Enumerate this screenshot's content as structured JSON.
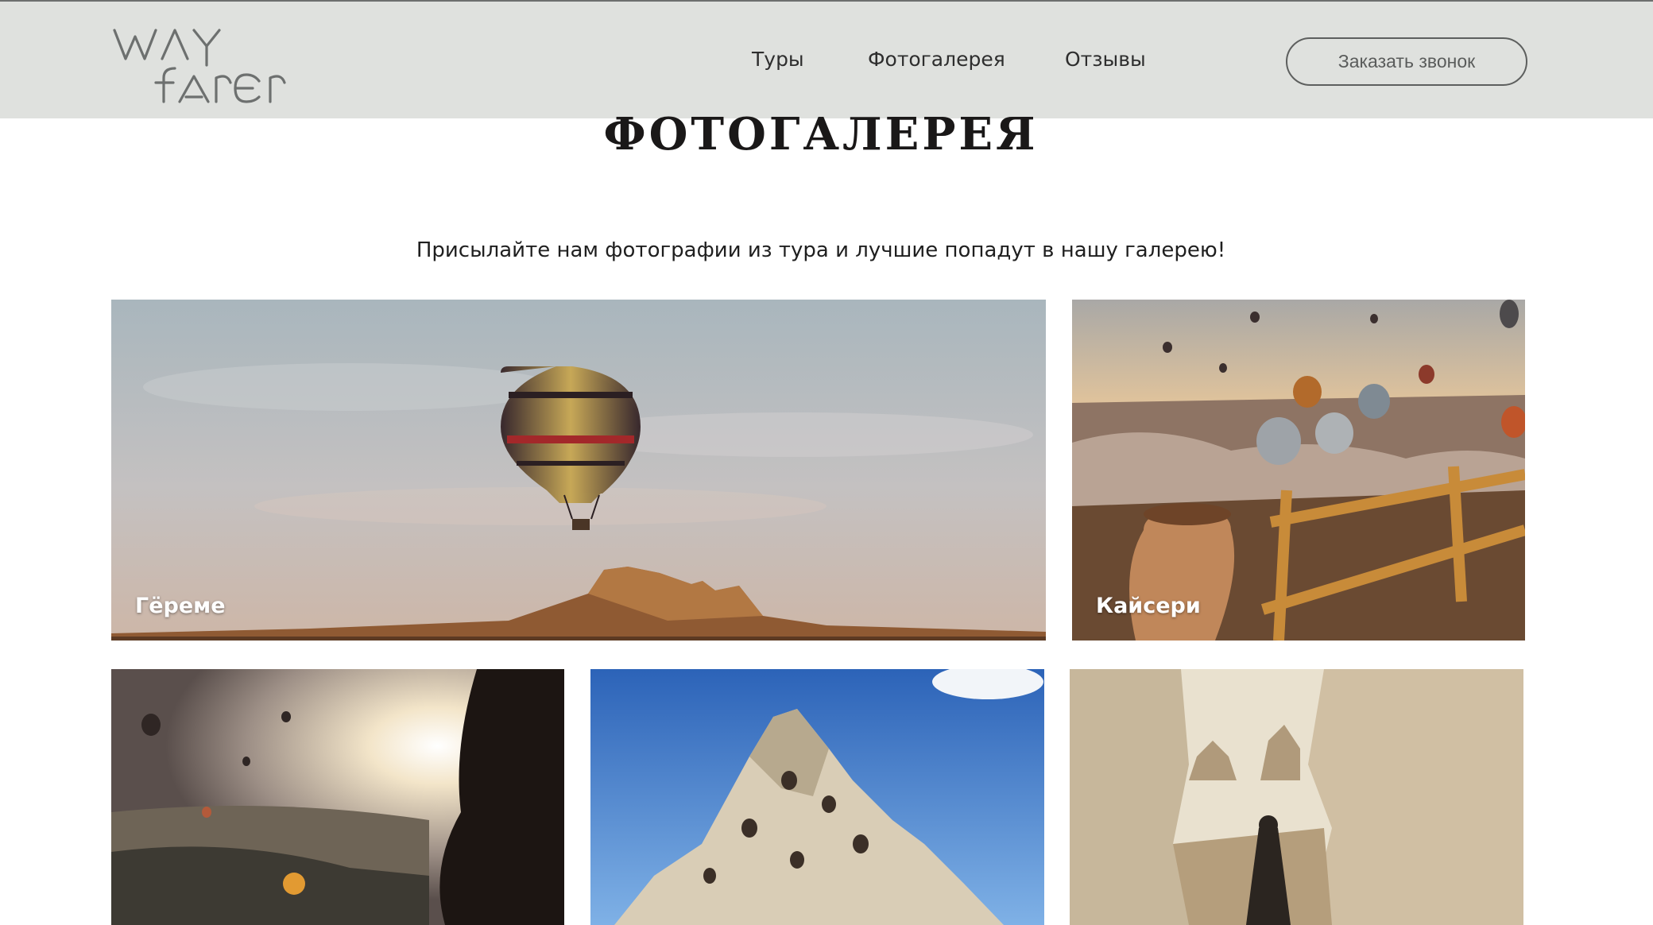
{
  "header": {
    "logo": {
      "line1": "WAY",
      "line2": "FARER"
    },
    "nav": {
      "tours": "Туры",
      "gallery": "Фотогалерея",
      "reviews": "Отзывы"
    },
    "cta_label": "Заказать звонок"
  },
  "page": {
    "title": "ФОТОГАЛЕРЕЯ",
    "subtitle": "Присылайте нам фотографии из тура и лучшие попадут в нашу галерею!"
  },
  "gallery": {
    "tiles": [
      {
        "label": "Гёреме",
        "photo": "hot-air-balloon-over-rock-castle"
      },
      {
        "label": "Кайсери",
        "photo": "balloons-over-valley-with-clay-jug"
      },
      {
        "label": "",
        "photo": "woman-watching-balloons-at-sunrise"
      },
      {
        "label": "",
        "photo": "cave-dwelling-rock-formation"
      },
      {
        "label": "",
        "photo": "rider-in-canyon"
      }
    ]
  },
  "colors": {
    "header_bg": "#dfe1de",
    "text_dark": "#1a1818",
    "logo": "#6d706f"
  }
}
